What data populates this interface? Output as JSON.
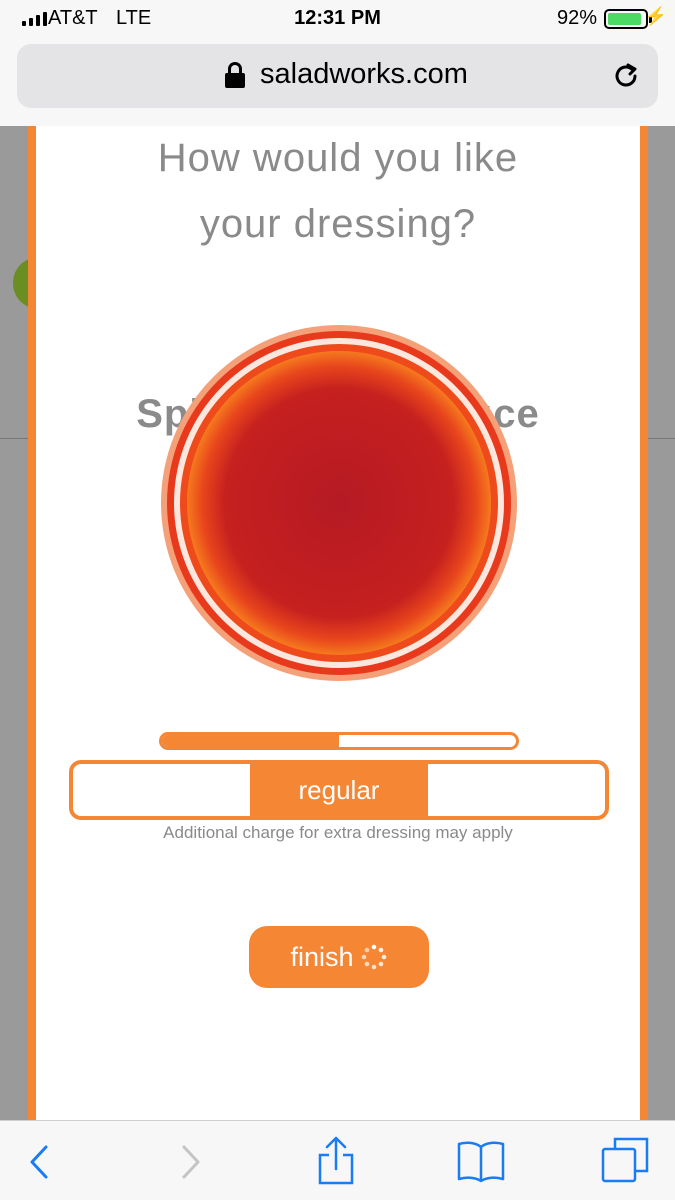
{
  "status_bar": {
    "carrier": "AT&T",
    "network": "LTE",
    "time": "12:31 PM",
    "battery_percent": "92%",
    "battery_level": 0.92
  },
  "browser": {
    "url": "saladworks.com"
  },
  "modal": {
    "question_line1": "How would you like",
    "question_line2": "your dressing?",
    "product_name": "Spicy Buffalo Sauce",
    "amount_level": 0.5,
    "amount_options": [
      "",
      "regular",
      ""
    ],
    "selected_option": "regular",
    "note": "Additional charge for extra dressing may apply",
    "finish_label": "finish"
  },
  "colors": {
    "accent": "#f58634",
    "text_gray": "#8a8a8a",
    "battery_green": "#4cd964",
    "link_blue": "#1a7cf5"
  },
  "icons": {
    "toolbar": [
      "back-icon",
      "forward-icon",
      "share-icon",
      "bookmarks-icon",
      "tabs-icon"
    ]
  }
}
